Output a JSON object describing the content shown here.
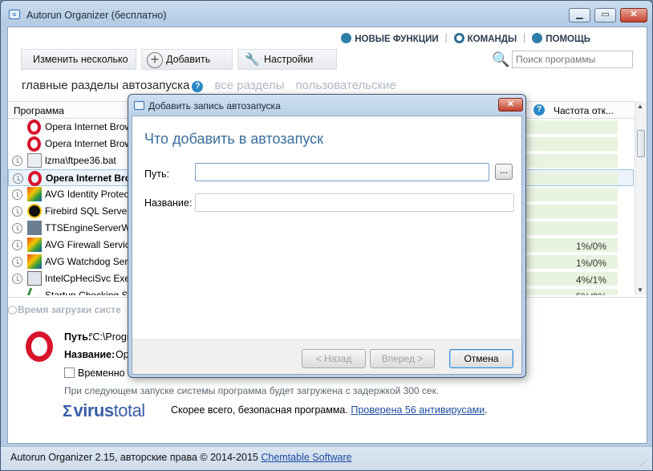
{
  "window": {
    "title": "Autorun Organizer (бесплатно)",
    "min": "▁",
    "max": "▭",
    "close": "✕"
  },
  "toplinks": {
    "news": "НОВЫЕ ФУНКЦИИ",
    "commands": "КОМАНДЫ",
    "help": "ПОМОЩЬ"
  },
  "toolbar": {
    "edit_multiple": "Изменить несколько",
    "add": "Добавить",
    "settings": "Настройки"
  },
  "search": {
    "placeholder": "Поиск программы"
  },
  "tabs": {
    "main": "главные разделы автозапуска",
    "all": "все разделы",
    "user": "пользовательские"
  },
  "list": {
    "columns": {
      "program": "Программа",
      "frequency": "Частота отк..."
    },
    "rows": [
      {
        "name": "Opera Internet Brow",
        "icon": "opera-icon",
        "clock": false,
        "value": ""
      },
      {
        "name": "Opera Internet Brow",
        "icon": "opera-icon",
        "clock": false,
        "value": ""
      },
      {
        "name": "lzma\\ftpee36.bat",
        "icon": "file-icon",
        "clock": true,
        "value": ""
      },
      {
        "name": "Opera Internet Bro",
        "icon": "opera-icon",
        "clock": true,
        "value": "",
        "selected": true
      },
      {
        "name": "AVG Identity Protec",
        "icon": "avg-icon",
        "clock": true,
        "value": ""
      },
      {
        "name": "Firebird SQL Server",
        "icon": "firebird-icon",
        "clock": true,
        "value": ""
      },
      {
        "name": "TTSEngineServerWi",
        "icon": "service-icon",
        "clock": true,
        "value": ""
      },
      {
        "name": "AVG Firewall Service",
        "icon": "avg-icon",
        "clock": true,
        "value": "1%/0%"
      },
      {
        "name": "AVG Watchdog Serv",
        "icon": "avg-icon",
        "clock": true,
        "value": "1%/0%"
      },
      {
        "name": "IntelCpHeciSvc Exec",
        "icon": "intel-icon",
        "clock": true,
        "value": "4%/1%"
      },
      {
        "name": "Startup Checking S",
        "icon": "check-icon",
        "clock": false,
        "value": "5%/0%"
      }
    ]
  },
  "details": {
    "tab": "Время загрузки систе",
    "path_label": "Путь:",
    "path_value": "\"C:\\Progr",
    "name_label": "Название:",
    "name_value": "Op",
    "temp_label": "Временно о",
    "delay_text": "При следующем запуске системы программа будет загружена с задержкой 300 сек.",
    "vt_logo_bold": "virus",
    "vt_logo_light": "total",
    "vt_status": "Скорее всего, безопасная программа. ",
    "vt_link": "Проверена 56 антивирусами",
    "vt_period": "."
  },
  "statusbar": {
    "text": "Autorun Organizer 2.15, авторские права © 2014-2015 ",
    "link": "Chemtable Software"
  },
  "dialog": {
    "title": "Добавить запись автозапуска",
    "heading": "Что добавить в автозапуск",
    "path_label": "Путь:",
    "path_value": "",
    "browse": "...",
    "name_label": "Название:",
    "name_value": "",
    "back": "< Назад",
    "next": "Вперед >",
    "cancel": "Отмена",
    "close": "✕"
  },
  "colors": {
    "accent": "#3a6f9c",
    "opera_red": "#d8142b",
    "link": "#1c4ca3"
  }
}
